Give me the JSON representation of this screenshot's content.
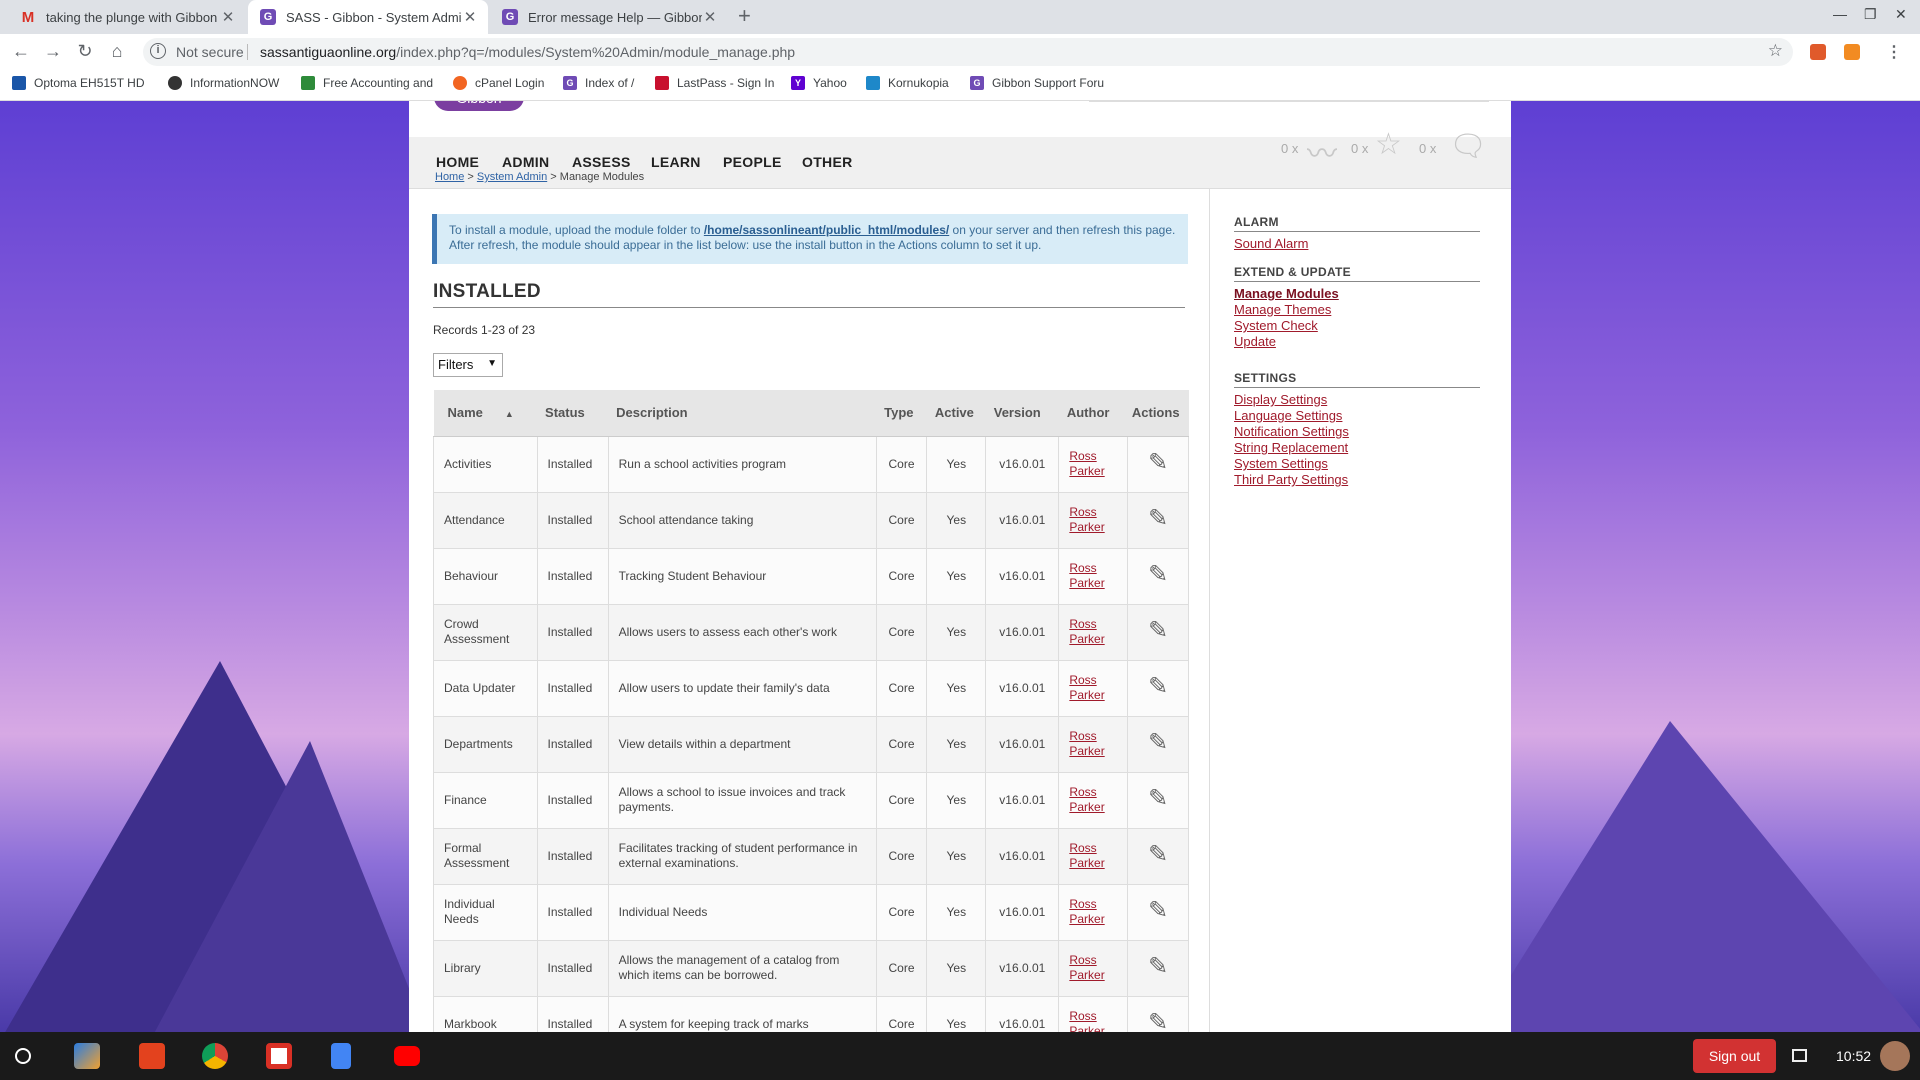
{
  "browser": {
    "tabs": [
      {
        "title": "taking the plunge with Gibbon - G",
        "icon": "gmail-icon",
        "color": "#d93025",
        "active": false
      },
      {
        "title": "SASS - Gibbon - System Admin",
        "icon": "gibbon-icon",
        "color": "#6f4bb5",
        "active": true
      },
      {
        "title": "Error message Help — Gibbon Su",
        "icon": "gibbon-icon",
        "color": "#6f4bb5",
        "active": false
      }
    ],
    "security_label": "Not secure",
    "url_host": "sassantiguaonline.org",
    "url_path": "/index.php?q=/modules/System%20Admin/module_manage.php",
    "bookmarks": [
      {
        "label": "Optoma EH515T HD",
        "color": "#1a56a8"
      },
      {
        "label": "InformationNOW",
        "color": "#333333"
      },
      {
        "label": "Free Accounting and",
        "color": "#2e8b3a"
      },
      {
        "label": "cPanel Login",
        "color": "#f26522"
      },
      {
        "label": "Index of /",
        "color": "#6f4bb5"
      },
      {
        "label": "LastPass - Sign In",
        "color": "#c8102e"
      },
      {
        "label": "Yahoo",
        "color": "#5f01d1"
      },
      {
        "label": "Kornukopia",
        "color": "#1e88c9"
      },
      {
        "label": "Gibbon Support Foru",
        "color": "#6f4bb5"
      }
    ]
  },
  "site": {
    "logo": "Gibbon",
    "nav": [
      "HOME",
      "ADMIN",
      "ASSESS",
      "LEARN",
      "PEOPLE",
      "OTHER"
    ],
    "notifications": [
      "0 x",
      "0 x",
      "0 x"
    ],
    "breadcrumb": {
      "home": "Home",
      "section": "System Admin",
      "current": "Manage Modules",
      "sep": ">"
    },
    "notice": {
      "before": "To install a module, upload the module folder to ",
      "path": "/home/sassonlineant/public_html/modules/",
      "after": " on your server and then refresh this page. After refresh, the module should appear in the list below: use the install button in the Actions column to set it up."
    },
    "heading": "INSTALLED",
    "records": "Records 1-23 of 23",
    "filter_label": "Filters",
    "columns": [
      "Name",
      "Status",
      "Description",
      "Type",
      "Active",
      "Version",
      "Author",
      "Actions"
    ],
    "rows": [
      {
        "name": "Activities",
        "status": "Installed",
        "description": "Run a school activities program",
        "type": "Core",
        "active": "Yes",
        "version": "v16.0.01",
        "author1": "Ross",
        "author2": "Parker"
      },
      {
        "name": "Attendance",
        "status": "Installed",
        "description": "School attendance taking",
        "type": "Core",
        "active": "Yes",
        "version": "v16.0.01",
        "author1": "Ross",
        "author2": "Parker"
      },
      {
        "name": "Behaviour",
        "status": "Installed",
        "description": "Tracking Student Behaviour",
        "type": "Core",
        "active": "Yes",
        "version": "v16.0.01",
        "author1": "Ross",
        "author2": "Parker"
      },
      {
        "name": "Crowd Assessment",
        "status": "Installed",
        "description": "Allows users to assess each other's work",
        "type": "Core",
        "active": "Yes",
        "version": "v16.0.01",
        "author1": "Ross",
        "author2": "Parker"
      },
      {
        "name": "Data Updater",
        "status": "Installed",
        "description": "Allow users to update their family's data",
        "type": "Core",
        "active": "Yes",
        "version": "v16.0.01",
        "author1": "Ross",
        "author2": "Parker"
      },
      {
        "name": "Departments",
        "status": "Installed",
        "description": "View details within a department",
        "type": "Core",
        "active": "Yes",
        "version": "v16.0.01",
        "author1": "Ross",
        "author2": "Parker"
      },
      {
        "name": "Finance",
        "status": "Installed",
        "description": "Allows a school to issue invoices and track payments.",
        "type": "Core",
        "active": "Yes",
        "version": "v16.0.01",
        "author1": "Ross",
        "author2": "Parker"
      },
      {
        "name": "Formal Assessment",
        "status": "Installed",
        "description": "Facilitates tracking of student performance in external examinations.",
        "type": "Core",
        "active": "Yes",
        "version": "v16.0.01",
        "author1": "Ross",
        "author2": "Parker"
      },
      {
        "name": "Individual Needs",
        "status": "Installed",
        "description": "Individual Needs",
        "type": "Core",
        "active": "Yes",
        "version": "v16.0.01",
        "author1": "Ross",
        "author2": "Parker"
      },
      {
        "name": "Library",
        "status": "Installed",
        "description": "Allows the management of a catalog from which items can be borrowed.",
        "type": "Core",
        "active": "Yes",
        "version": "v16.0.01",
        "author1": "Ross",
        "author2": "Parker"
      },
      {
        "name": "Markbook",
        "status": "Installed",
        "description": "A system for keeping track of marks",
        "type": "Core",
        "active": "Yes",
        "version": "v16.0.01",
        "author1": "Ross",
        "author2": "Parker"
      }
    ],
    "sidebar": {
      "alarm": {
        "title": "ALARM",
        "links": [
          "Sound Alarm"
        ]
      },
      "extend": {
        "title": "EXTEND & UPDATE",
        "links": [
          "Manage Modules",
          "Manage Themes",
          "System Check",
          "Update"
        ]
      },
      "settings": {
        "title": "SETTINGS",
        "links": [
          "Display Settings",
          "Language Settings",
          "Notification Settings",
          "String Replacement",
          "System Settings",
          "Third Party Settings"
        ]
      }
    }
  },
  "shelf": {
    "signout": "Sign out",
    "time": "10:52"
  }
}
